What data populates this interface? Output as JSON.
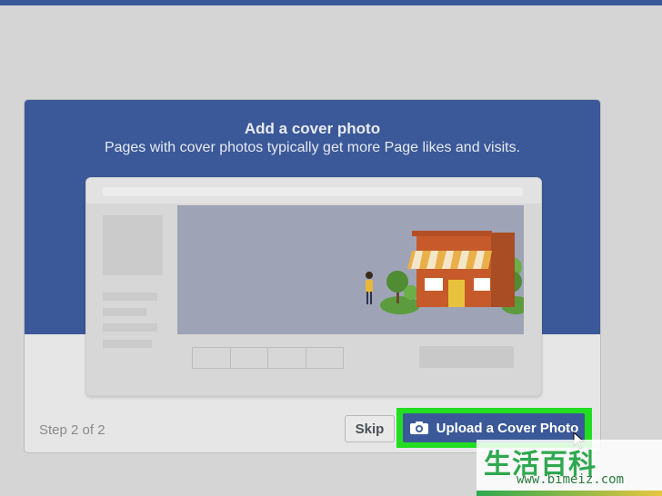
{
  "dialog": {
    "title": "Add a cover photo",
    "subtitle": "Pages with cover photos typically get more Page likes and visits.",
    "step_text": "Step 2 of 2",
    "skip_label": "Skip",
    "upload_label": "Upload a Cover Photo",
    "upload_icon": "camera-icon"
  },
  "colors": {
    "brand_blue": "#3b5998",
    "highlight_green": "#22dd22",
    "page_background": "#d5d5d5"
  },
  "watermark": {
    "chars": "生活百科",
    "url": "www.bimeiz.com"
  }
}
